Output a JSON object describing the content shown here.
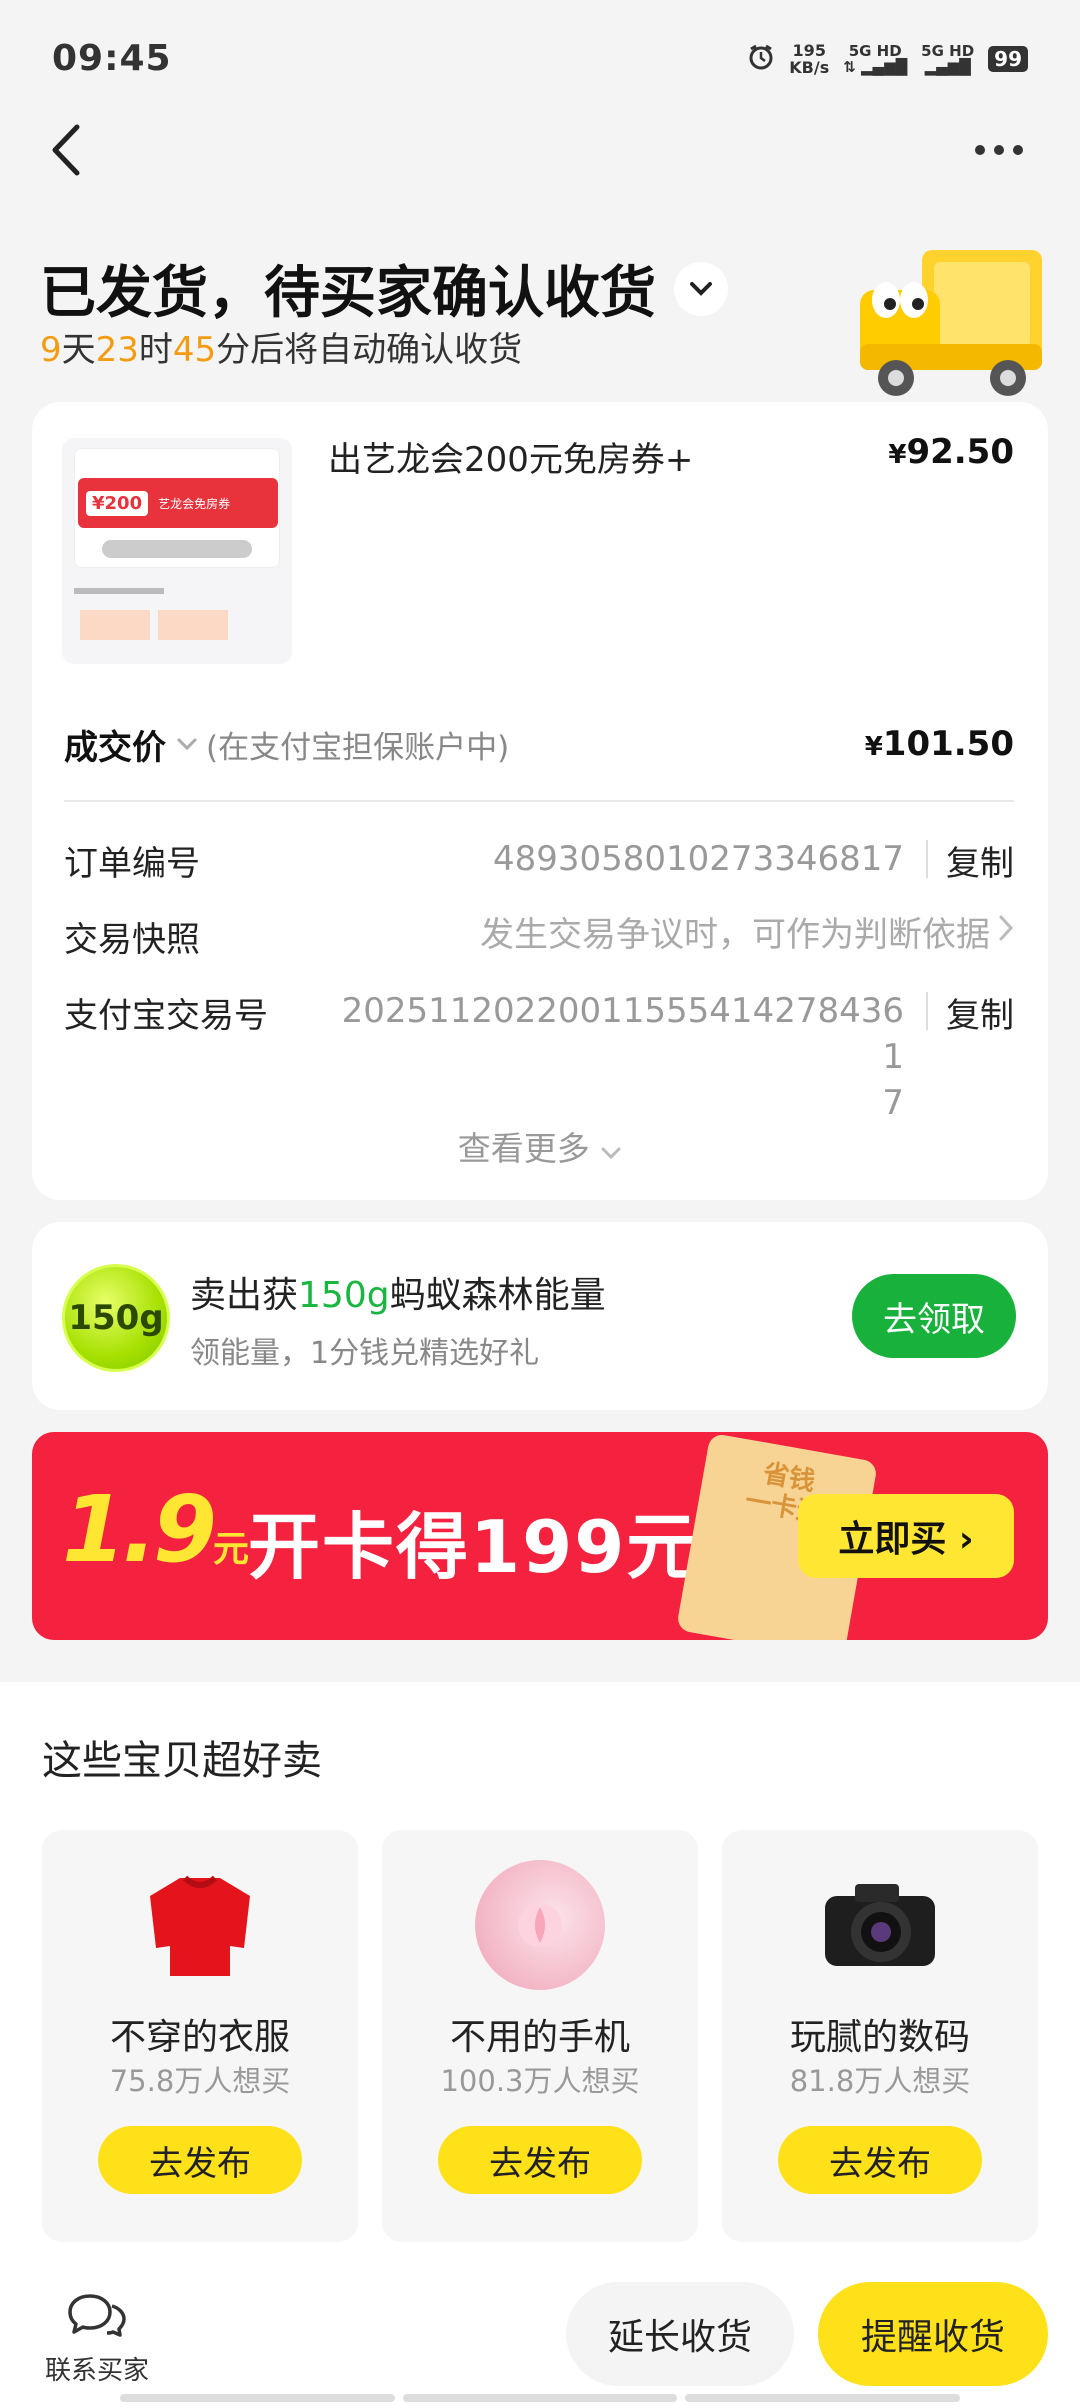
{
  "status_bar": {
    "time": "09:45",
    "speed_value": "195",
    "speed_unit": "KB/s",
    "net1": "5G HD",
    "net2": "5G HD",
    "battery": "99"
  },
  "header": {
    "title": "已发货，待买家确认收货",
    "countdown_days": "9",
    "countdown_days_unit": "天",
    "countdown_hours": "23",
    "countdown_hours_unit": "时",
    "countdown_minutes": "45",
    "countdown_suffix": "分后将自动确认收货"
  },
  "product": {
    "title": "出艺龙会200元免房券+",
    "price_symbol": "¥",
    "price": "92.50",
    "thumb_text": "¥200",
    "thumb_label": "艺龙会免房券",
    "deal_label": "成交价",
    "deal_sub": "(在支付宝担保账户中)",
    "deal_price_symbol": "¥",
    "deal_price": "101.50"
  },
  "order_info": {
    "order_no_label": "订单编号",
    "order_no": "4893058010273346817",
    "order_no_action": "复制",
    "snapshot_label": "交易快照",
    "snapshot_value": "发生交易争议时，可作为判断依据",
    "alipay_label": "支付宝交易号",
    "alipay_no_line1": "20251120220011555414278436​1",
    "alipay_no_line2": "7",
    "alipay_action": "复制",
    "see_more": "查看更多"
  },
  "energy": {
    "ball_text": "150g",
    "title_prefix": "卖出获",
    "title_amount": "150g",
    "title_suffix": "蚂蚁森林能量",
    "subtitle": "领能量，1分钱兑精选好礼",
    "button": "去领取"
  },
  "banner": {
    "price": "1.9",
    "price_unit": "元",
    "text": "开卡得199元券包",
    "card_line1": "省钱",
    "card_line2": "一卡通",
    "button": "立即买 ›"
  },
  "popular": {
    "title": "这些宝贝超好卖",
    "items": [
      {
        "name": "不穿的衣服",
        "count": "75.8万人想买",
        "button": "去发布"
      },
      {
        "name": "不用的手机",
        "count": "100.3万人想买",
        "button": "去发布"
      },
      {
        "name": "玩腻的数码",
        "count": "81.8万人想买",
        "button": "去发布"
      }
    ]
  },
  "bottom_bar": {
    "contact_label": "联系买家",
    "extend_button": "延长收货",
    "remind_button": "提醒收货"
  },
  "colors": {
    "accent_yellow": "#ffe11a",
    "countdown_orange": "#f39c12",
    "energy_green": "#17b13c",
    "banner_red": "#f4213f"
  }
}
